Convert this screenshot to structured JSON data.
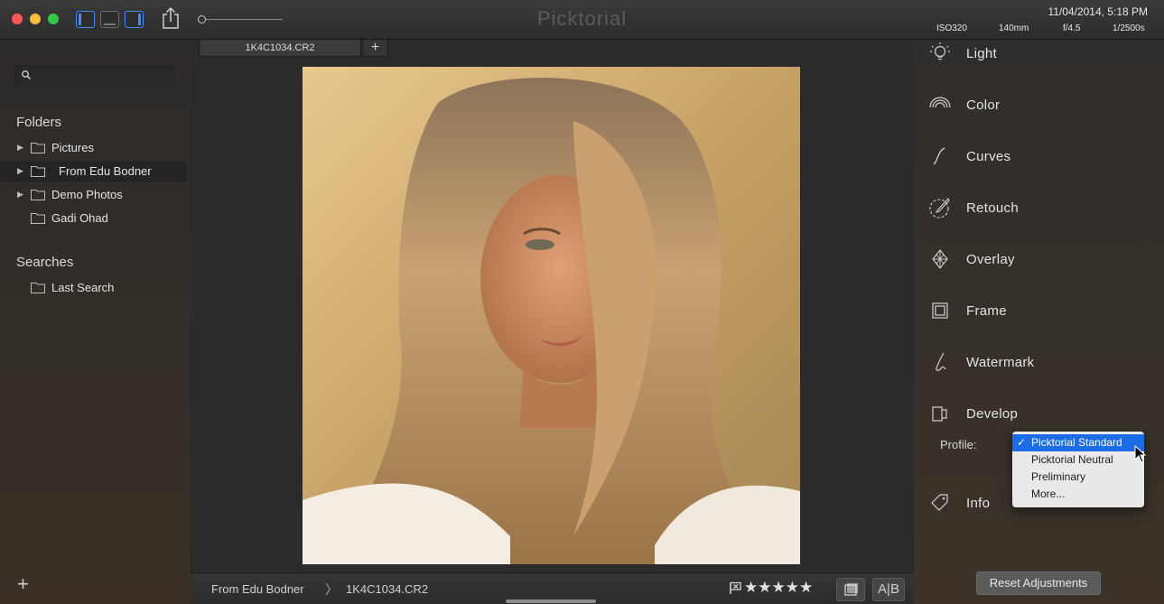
{
  "window": {
    "title": "Picktorial",
    "date": "11/04/2014, 5:18 PM",
    "exif": {
      "iso": "ISO320",
      "focal": "140mm",
      "aperture": "f/4.5",
      "shutter": "1/2500s"
    }
  },
  "sidebar": {
    "search": {
      "value": "",
      "placeholder": ""
    },
    "folders_title": "Folders",
    "folders": [
      {
        "label": "Pictures",
        "expandable": true
      },
      {
        "label": "From Edu Bodner",
        "expandable": true,
        "selected": true
      },
      {
        "label": "Demo Photos",
        "expandable": true
      },
      {
        "label": "Gadi Ohad",
        "expandable": false
      }
    ],
    "searches_title": "Searches",
    "searches": [
      {
        "label": "Last Search"
      }
    ],
    "add_label": "+"
  },
  "center": {
    "tab_label": "1K4C1034.CR2",
    "tab_add": "+",
    "breadcrumb": [
      "From Edu Bodner",
      "1K4C1034.CR2"
    ],
    "breadcrumb_sep": "〉",
    "rating": "★★★★★",
    "ab_label": "A|B"
  },
  "tools": {
    "items": [
      {
        "label": "Light",
        "icon": "light-bulb-icon"
      },
      {
        "label": "Color",
        "icon": "rainbow-icon"
      },
      {
        "label": "Curves",
        "icon": "curve-icon"
      },
      {
        "label": "Retouch",
        "icon": "brush-icon"
      },
      {
        "label": "Overlay",
        "icon": "overlay-icon"
      },
      {
        "label": "Frame",
        "icon": "frame-icon"
      },
      {
        "label": "Watermark",
        "icon": "watermark-icon"
      },
      {
        "label": "Develop",
        "icon": "develop-icon"
      },
      {
        "label": "Info",
        "icon": "tag-icon"
      }
    ],
    "profile_label": "Profile:",
    "profile_options": [
      "Picktorial Standard",
      "Picktorial Neutral",
      "Preliminary",
      "More..."
    ],
    "profile_selected": "Picktorial Standard",
    "reset_label": "Reset Adjustments"
  },
  "colors": {
    "accent": "#3d8bff",
    "selection": "#1c6ce8",
    "background": "#2b2b2b"
  }
}
